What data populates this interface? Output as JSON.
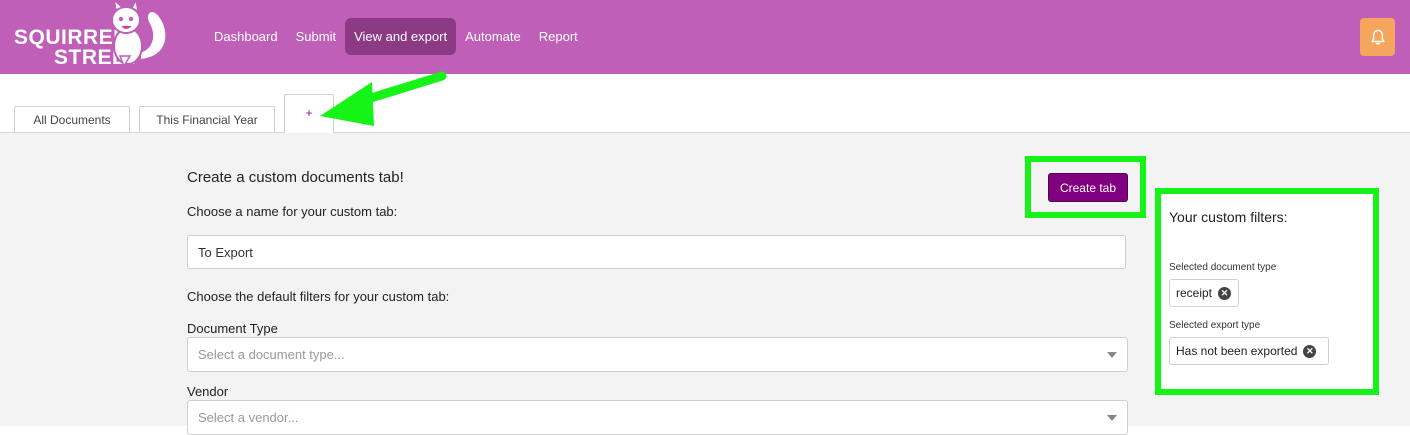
{
  "brand": {
    "line1": "SQUIRREL",
    "line2": "STREET"
  },
  "nav": {
    "items": [
      {
        "label": "Dashboard",
        "active": false
      },
      {
        "label": "Submit",
        "active": false
      },
      {
        "label": "View and export",
        "active": true
      },
      {
        "label": "Automate",
        "active": false
      },
      {
        "label": "Report",
        "active": false
      }
    ],
    "notification_icon": "bell-icon"
  },
  "tabs": {
    "items": [
      {
        "label": "All Documents"
      },
      {
        "label": "This Financial Year"
      },
      {
        "label": "+"
      }
    ]
  },
  "form": {
    "heading": "Create a custom documents tab!",
    "create_button": "Create tab",
    "name_label": "Choose a name for your custom tab:",
    "name_value": "To Export",
    "filters_label": "Choose the default filters for your custom tab:",
    "document_type_label": "Document Type",
    "document_type_placeholder": "Select a document type...",
    "vendor_label": "Vendor",
    "vendor_placeholder": "Select a vendor..."
  },
  "custom_filters": {
    "title": "Your custom filters:",
    "document_type_label": "Selected document type",
    "document_type_chip": "receipt",
    "export_type_label": "Selected export type",
    "export_type_chip": "Has not been exported"
  },
  "colors": {
    "header": "#bf5fb8",
    "nav_active": "#8b3a83",
    "bell": "#f6a55c",
    "primary_button": "#800080",
    "highlight": "#16f316"
  }
}
